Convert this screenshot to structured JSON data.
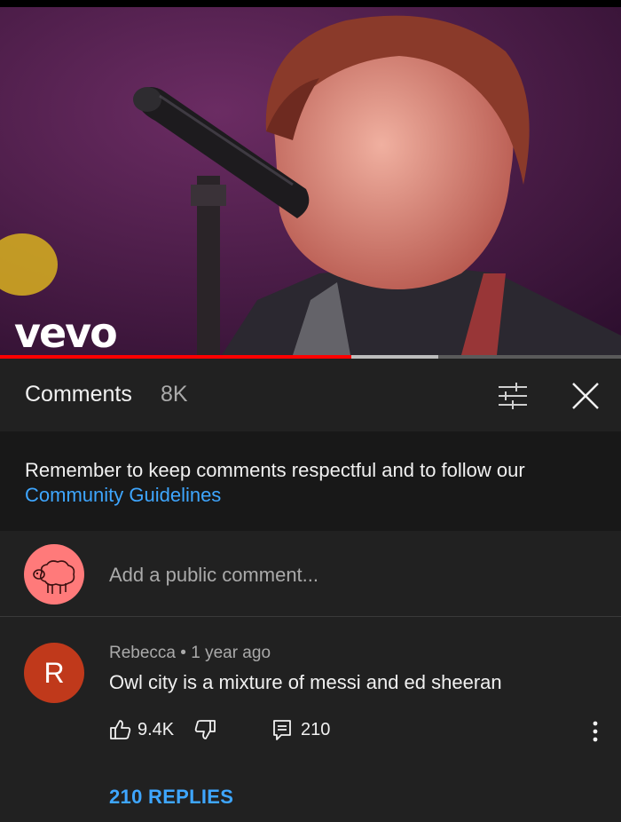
{
  "video": {
    "logo_text": "vevo",
    "progress_played": 0.565,
    "progress_buffered": 0.705
  },
  "comments_panel": {
    "title": "Comments",
    "count": "8K",
    "icons": {
      "filter": "sort-filter-icon",
      "close": "close-icon"
    }
  },
  "guidelines": {
    "text": "Remember to keep comments respectful and to follow our",
    "link_text": "Community Guidelines"
  },
  "add_comment": {
    "placeholder": "Add a public comment...",
    "avatar_icon": "sheep-avatar-icon"
  },
  "comment": {
    "avatar_letter": "R",
    "author": "Rebecca",
    "separator": " • ",
    "time": "1 year ago",
    "text": "Owl city is a mixture of messi and ed sheeran",
    "likes": "9.4K",
    "reply_count": "210",
    "replies_link": "210 REPLIES",
    "icons": {
      "like": "thumbs-up-icon",
      "dislike": "thumbs-down-icon",
      "reply": "reply-icon",
      "more": "more-vert-icon"
    }
  },
  "colors": {
    "background": "#212121",
    "guidelines_bg": "#181818",
    "link": "#3ea6ff",
    "progress": "#ff0000",
    "avatar_r": "#c0391b",
    "avatar_sheep": "#ff7a7a"
  }
}
